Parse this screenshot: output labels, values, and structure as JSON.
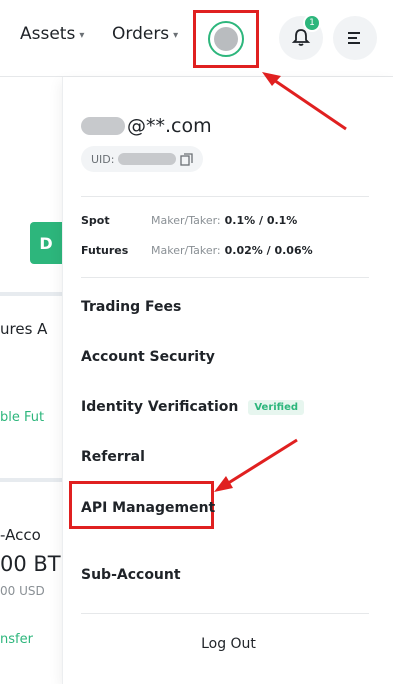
{
  "header": {
    "assets_label": "Assets",
    "orders_label": "Orders",
    "notification_count": "1"
  },
  "background_page": {
    "green_button_text": "D",
    "futures_text": "ures A",
    "able_futures_text": "ble Fut",
    "sub_account_text": "-Acco",
    "balance_text": "00 BT",
    "balance_usd_text": "00 USD",
    "transfer_text": "nsfer"
  },
  "account_menu": {
    "email_suffix": "@**.com",
    "uid_label": "UID:",
    "fees": [
      {
        "market": "Spot",
        "maker_taker_label": "Maker/Taker:",
        "value": "0.1% / 0.1%"
      },
      {
        "market": "Futures",
        "maker_taker_label": "Maker/Taker:",
        "value": "0.02% / 0.06%"
      }
    ],
    "items": [
      {
        "label": "Trading Fees"
      },
      {
        "label": "Account Security"
      },
      {
        "label": "Identity Verification",
        "badge": "Verified"
      },
      {
        "label": "Referral"
      },
      {
        "label": "API Management"
      },
      {
        "label": "Sub-Account"
      }
    ],
    "logout_label": "Log Out"
  },
  "colors": {
    "accent_green": "#2db67c",
    "highlight_red": "#e02020"
  }
}
